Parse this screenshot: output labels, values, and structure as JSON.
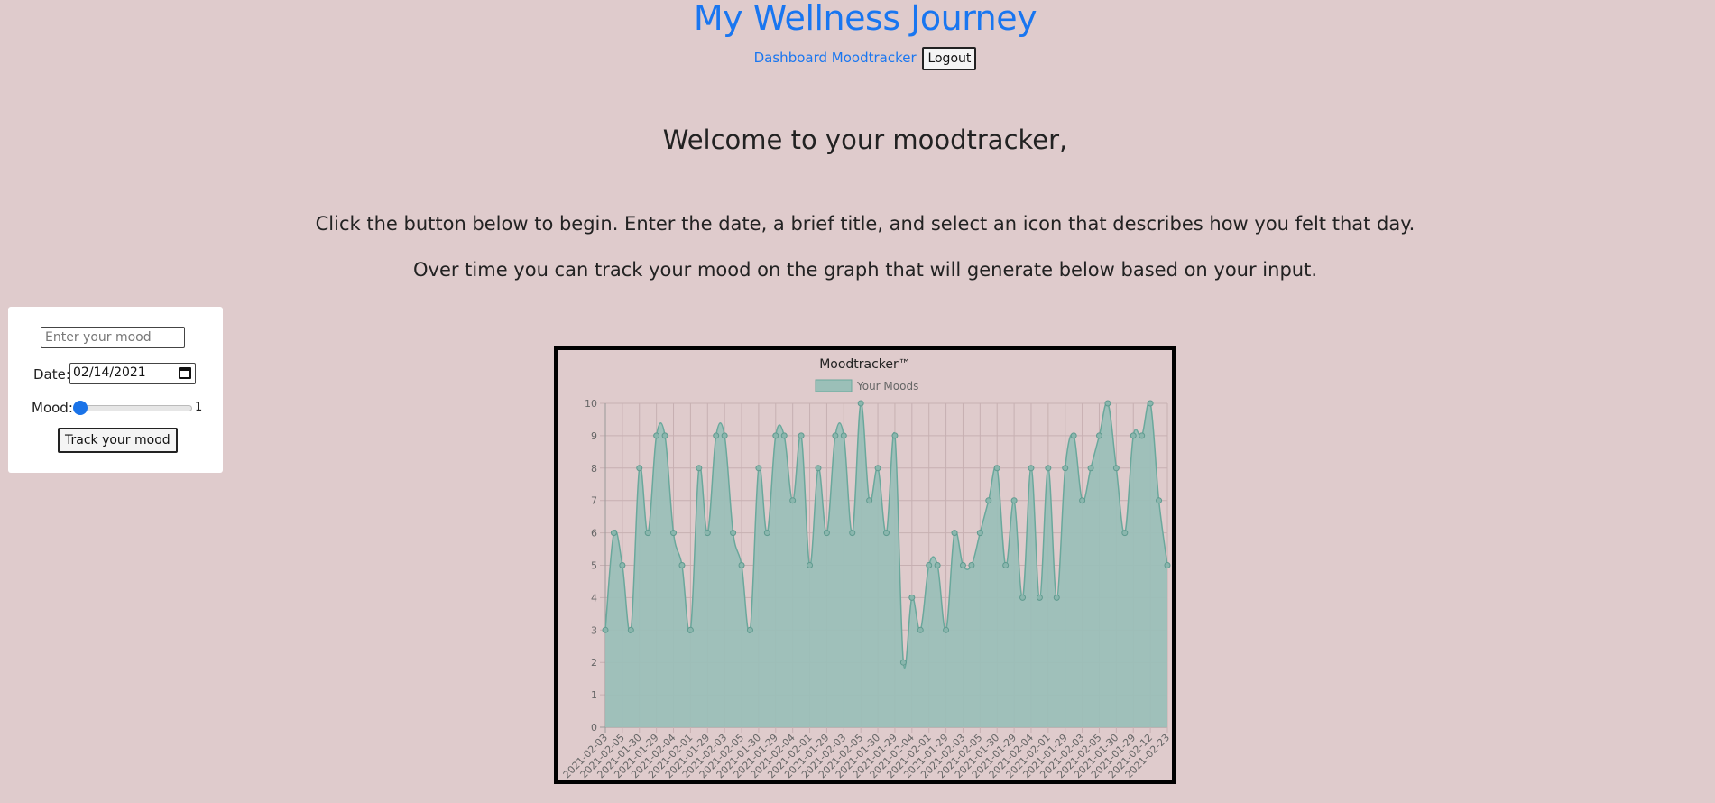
{
  "header": {
    "title": "My Wellness Journey",
    "nav": {
      "dashboard": "Dashboard",
      "moodtracker": "Moodtracker",
      "logout": "Logout"
    }
  },
  "main": {
    "welcome": "Welcome to your moodtracker,",
    "intro_line_1": "Click the button below to begin. Enter the date, a brief title, and select an icon that describes how you felt that day.",
    "intro_line_2": "Over time you can track your mood on the graph that will generate below based on your input."
  },
  "form": {
    "mood_placeholder": "Enter your mood",
    "date_label": "Date:",
    "date_value": "02/14/2021",
    "mood_label": "Mood:",
    "mood_value": "1",
    "slider": {
      "min": 1,
      "max": 10,
      "value": 1
    },
    "submit_label": "Track your mood",
    "icons": {
      "date_picker": "calendar-icon"
    }
  },
  "colors": {
    "accent": "#1976f0",
    "background": "#dfcbcc",
    "chart_fill": "#9bbfb8",
    "chart_line": "#6aa89c"
  },
  "chart_data": {
    "type": "area",
    "title": "Moodtracker™",
    "legend": {
      "position": "top",
      "entries": [
        "Your Moods"
      ]
    },
    "ylim": [
      0,
      10
    ],
    "yticks": [
      0,
      1,
      2,
      3,
      4,
      5,
      6,
      7,
      8,
      9,
      10
    ],
    "grid": true,
    "series": [
      {
        "name": "Your Moods",
        "values": [
          3,
          6,
          5,
          3,
          8,
          6,
          9,
          9,
          6,
          5,
          3,
          8,
          6,
          9,
          9,
          6,
          5,
          3,
          8,
          6,
          9,
          9,
          7,
          9,
          5,
          8,
          6,
          9,
          9,
          6,
          10,
          7,
          8,
          6,
          9,
          2,
          4,
          3,
          5,
          5,
          3,
          6,
          5,
          5,
          6,
          7,
          8,
          5,
          7,
          4,
          8,
          4,
          8,
          4,
          8,
          9,
          7,
          8,
          9,
          10,
          8,
          6,
          9,
          9,
          10,
          7,
          5
        ]
      }
    ],
    "x": [
      "2021-02-03",
      "2021-02-05",
      "2021-01-30",
      "2021-01-29",
      "2021-02-04",
      "2021-02-01",
      "2021-01-29",
      "2021-02-03",
      "2021-02-05",
      "2021-01-30",
      "2021-01-29",
      "2021-02-04",
      "2021-02-01",
      "2021-01-29",
      "2021-02-03",
      "2021-02-05",
      "2021-01-30",
      "2021-01-29",
      "2021-02-04",
      "2021-02-01",
      "2021-01-29",
      "2021-02-03",
      "2021-02-05",
      "2021-01-30",
      "2021-01-29",
      "2021-02-04",
      "2021-02-01",
      "2021-01-29",
      "2021-02-03",
      "2021-02-05",
      "2021-01-30",
      "2021-01-29",
      "2021-02-04",
      "2021-02-01",
      "2021-01-29",
      "2021-02-03",
      "2021-02-05",
      "2021-01-30",
      "2021-01-29",
      "2021-02-04",
      "2021-02-01",
      "2021-01-29",
      "2021-02-03",
      "2021-02-05",
      "2021-01-30",
      "2021-01-29",
      "2021-02-04",
      "2021-02-01",
      "2021-01-29",
      "2021-02-03",
      "2021-02-05",
      "2021-01-30",
      "2021-01-29",
      "2021-02-04",
      "2021-02-01",
      "2021-01-29",
      "2021-02-03",
      "2021-02-05",
      "2021-01-30",
      "2021-01-29",
      "2021-02-04",
      "2021-02-01",
      "2021-01-29",
      "2021-02-03",
      "2021-02-05",
      "2021-02-12",
      "2021-02-23"
    ],
    "xtick_labels": [
      "2021-02-03",
      "2021-02-05",
      "2021-01-30",
      "2021-01-29",
      "2021-02-04",
      "2021-02-01",
      "2021-01-29",
      "2021-02-03",
      "2021-02-05",
      "2021-01-30",
      "2021-01-29",
      "2021-02-04",
      "2021-02-01",
      "2021-01-29",
      "2021-02-03",
      "2021-02-05",
      "2021-01-30",
      "2021-01-29",
      "2021-02-04",
      "2021-02-01",
      "2021-01-29",
      "2021-02-03",
      "2021-02-05",
      "2021-01-30",
      "2021-01-29",
      "2021-02-04",
      "2021-02-01",
      "2021-01-29",
      "2021-02-03",
      "2021-02-05",
      "2021-01-30",
      "2021-01-29",
      "2021-02-12",
      "2021-02-23"
    ]
  }
}
